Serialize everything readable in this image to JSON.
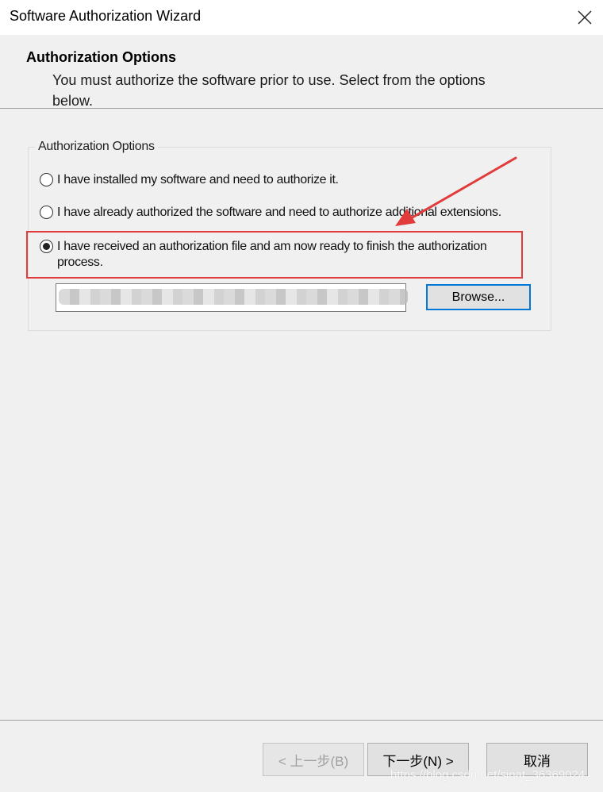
{
  "window": {
    "title": "Software Authorization Wizard",
    "close_icon": "close-icon"
  },
  "header": {
    "title": "Authorization Options",
    "description": "You must authorize the software prior to use. Select from the options below."
  },
  "group": {
    "legend": "Authorization Options",
    "options": [
      {
        "label": "I have installed my software and need to authorize it.",
        "selected": false
      },
      {
        "label": "I have already authorized the software and need to authorize additional extensions.",
        "selected": false
      },
      {
        "label": "I have received an authorization file and am now ready to finish the authorization process.",
        "selected": true
      }
    ],
    "file_path": "",
    "browse_label": "Browse..."
  },
  "footer": {
    "back_label": "< 上一步(B)",
    "next_label": "下一步(N) >",
    "cancel_label": "取消"
  },
  "annotation": {
    "highlight_color": "#e23b3b",
    "arrow_color": "#e23b3b"
  },
  "watermark": "https://blog.csdn.net/sinat_36369024",
  "colors": {
    "accent": "#0078d7",
    "background": "#f0f0f0"
  }
}
